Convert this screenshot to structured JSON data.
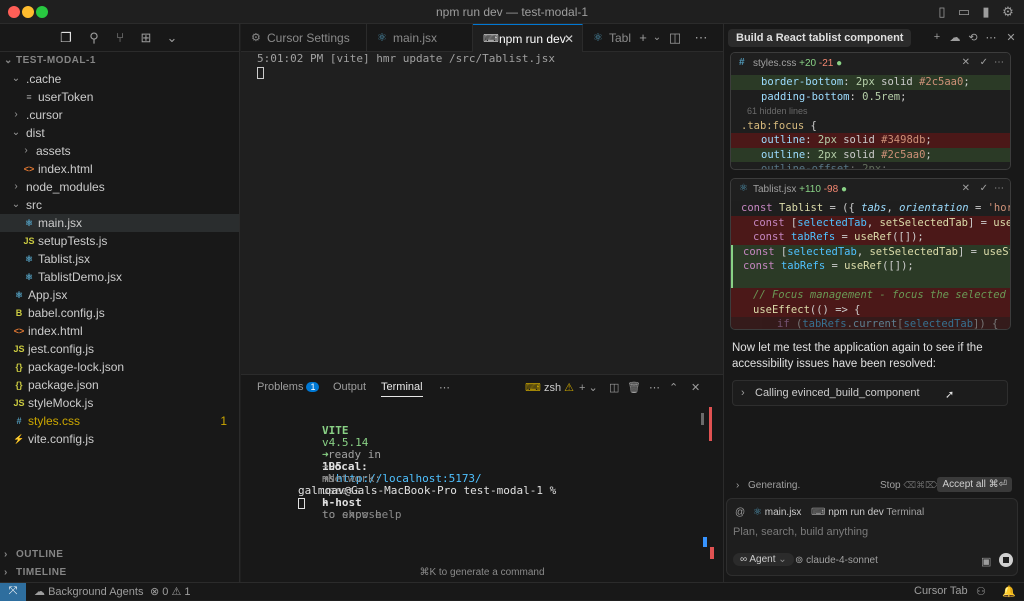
{
  "window": {
    "title": "npm run dev — test-modal-1"
  },
  "traffic_colors": {
    "close": "#ff5f57",
    "minimize": "#febc2e",
    "maximize": "#28c840"
  },
  "sidebar": {
    "root": "TEST-MODAL-1",
    "items": [
      {
        "label": ".cache",
        "type": "folder",
        "open": true
      },
      {
        "label": "userToken",
        "type": "file"
      },
      {
        "label": ".cursor",
        "type": "folder",
        "open": false
      },
      {
        "label": "dist",
        "type": "folder",
        "open": true
      },
      {
        "label": "assets",
        "type": "folder",
        "open": false
      },
      {
        "label": "index.html",
        "type": "html"
      },
      {
        "label": "node_modules",
        "type": "folder",
        "open": false
      },
      {
        "label": "src",
        "type": "folder",
        "open": true
      },
      {
        "label": "main.jsx",
        "type": "react"
      },
      {
        "label": "setupTests.js",
        "type": "js"
      },
      {
        "label": "Tablist.jsx",
        "type": "react"
      },
      {
        "label": "TablistDemo.jsx",
        "type": "react"
      },
      {
        "label": "App.jsx",
        "type": "react"
      },
      {
        "label": "babel.config.js",
        "type": "babel"
      },
      {
        "label": "index.html",
        "type": "html"
      },
      {
        "label": "jest.config.js",
        "type": "js"
      },
      {
        "label": "package-lock.json",
        "type": "json"
      },
      {
        "label": "package.json",
        "type": "json"
      },
      {
        "label": "styleMock.js",
        "type": "js"
      },
      {
        "label": "styles.css",
        "type": "css",
        "badge": "1"
      },
      {
        "label": "vite.config.js",
        "type": "vite"
      }
    ],
    "outline": "OUTLINE",
    "timeline": "TIMELINE"
  },
  "editor": {
    "tabs": [
      {
        "label": "Cursor Settings"
      },
      {
        "label": "main.jsx"
      },
      {
        "label": "npm run dev"
      },
      {
        "label": "Tabl"
      }
    ],
    "top_output": [
      "5:01:02 PM [vite] hmr update /src/Tablist.jsx"
    ]
  },
  "panel": {
    "tabs": [
      "Problems",
      "Output",
      "Terminal"
    ],
    "problems_count": "1",
    "shell": "zsh",
    "terminal": {
      "vite_label": "VITE",
      "vite_version": "v4.5.14",
      "ready_text": "ready in",
      "ready_ms": "195",
      "ready_unit": "ms",
      "local_label": "Local:",
      "local_url": "http://localhost:5173/",
      "network_label": "Network:",
      "network_text_a": "use",
      "network_flag": "--host",
      "network_text_b": "to expose",
      "help_a": "press",
      "help_key": "h",
      "help_b": "to show help",
      "prompt": "galmoav@Gals-MacBook-Pro test-modal-1 %"
    },
    "hint": "⌘K to generate a command"
  },
  "chat": {
    "title": "Build a React tablist component",
    "card1": {
      "file": "styles.css",
      "add": "+20",
      "del": "-21",
      "hidden": "61 hidden lines"
    },
    "card2": {
      "file": "Tablist.jsx",
      "add": "+110",
      "del": "-98"
    },
    "message": "Now let me test the application again to see if the accessibility issues have been resolved:",
    "tool_call": "Calling evinced_build_component",
    "generating": "Generating.",
    "stop": "Stop",
    "stop_kbd": "⌫⌘⌦",
    "accept": "Accept all ⌘⏎",
    "input": {
      "chip1": "main.jsx",
      "chip2": "npm run dev",
      "chip2_suffix": "Terminal",
      "placeholder": "Plan, search, build anything",
      "mode": "Agent",
      "model": "claude-4-sonnet"
    }
  },
  "status": {
    "background_agents": "Background Agents",
    "errors": "0",
    "warnings": "1",
    "cursor_tab": "Cursor Tab"
  }
}
